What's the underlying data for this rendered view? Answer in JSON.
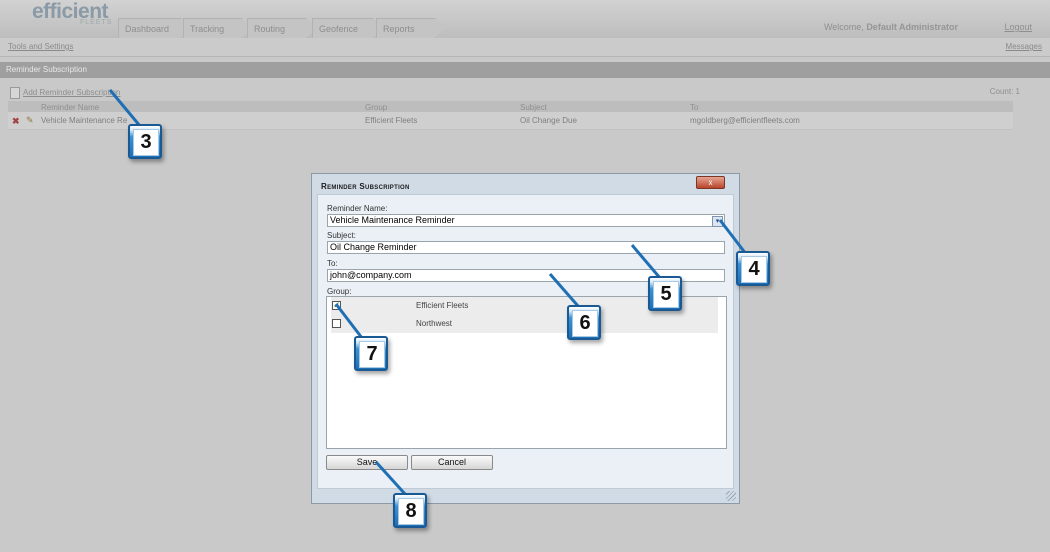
{
  "header": {
    "logo_text": "efficient",
    "logo_sub": "FLEETS",
    "tabs": [
      {
        "label": "Dashboard"
      },
      {
        "label": "Tracking"
      },
      {
        "label": "Routing"
      },
      {
        "label": "Geofence"
      },
      {
        "label": "Reports"
      }
    ],
    "welcome_prefix": "Welcome,",
    "user_name": "Default Administrator",
    "logout": "Logout"
  },
  "subbar": {
    "tools": "Tools and Settings",
    "messages": "Messages"
  },
  "section": {
    "title": "Reminder Subscription",
    "add_link": "Add Reminder Subscription",
    "count": "Count: 1"
  },
  "table": {
    "columns": [
      "Reminder Name",
      "Group",
      "Subject",
      "To"
    ],
    "rows": [
      {
        "name": "Vehicle Maintenance Re",
        "group": "Efficient Fleets",
        "subject": "Oil Change Due",
        "to": "mgoldberg@efficientfleets.com"
      }
    ]
  },
  "dialog": {
    "title": "Reminder Subscription",
    "close": "x",
    "reminder_label": "Reminder Name:",
    "reminder_value": "Vehicle Maintenance Reminder",
    "subject_label": "Subject:",
    "subject_value": "Oil Change Reminder",
    "to_label": "To:",
    "to_value": "john@company.com",
    "group_label": "Group:",
    "groups": [
      {
        "name": "Efficient Fleets",
        "checked": true
      },
      {
        "name": "Northwest",
        "checked": false
      }
    ],
    "save": "Save",
    "cancel": "Cancel"
  },
  "callouts": [
    "3",
    "4",
    "5",
    "6",
    "7",
    "8"
  ],
  "colors": {
    "callout_blue": "#1f6fb5",
    "close_red": "#b9452a",
    "dialog_bg": "#d0dbe6"
  }
}
